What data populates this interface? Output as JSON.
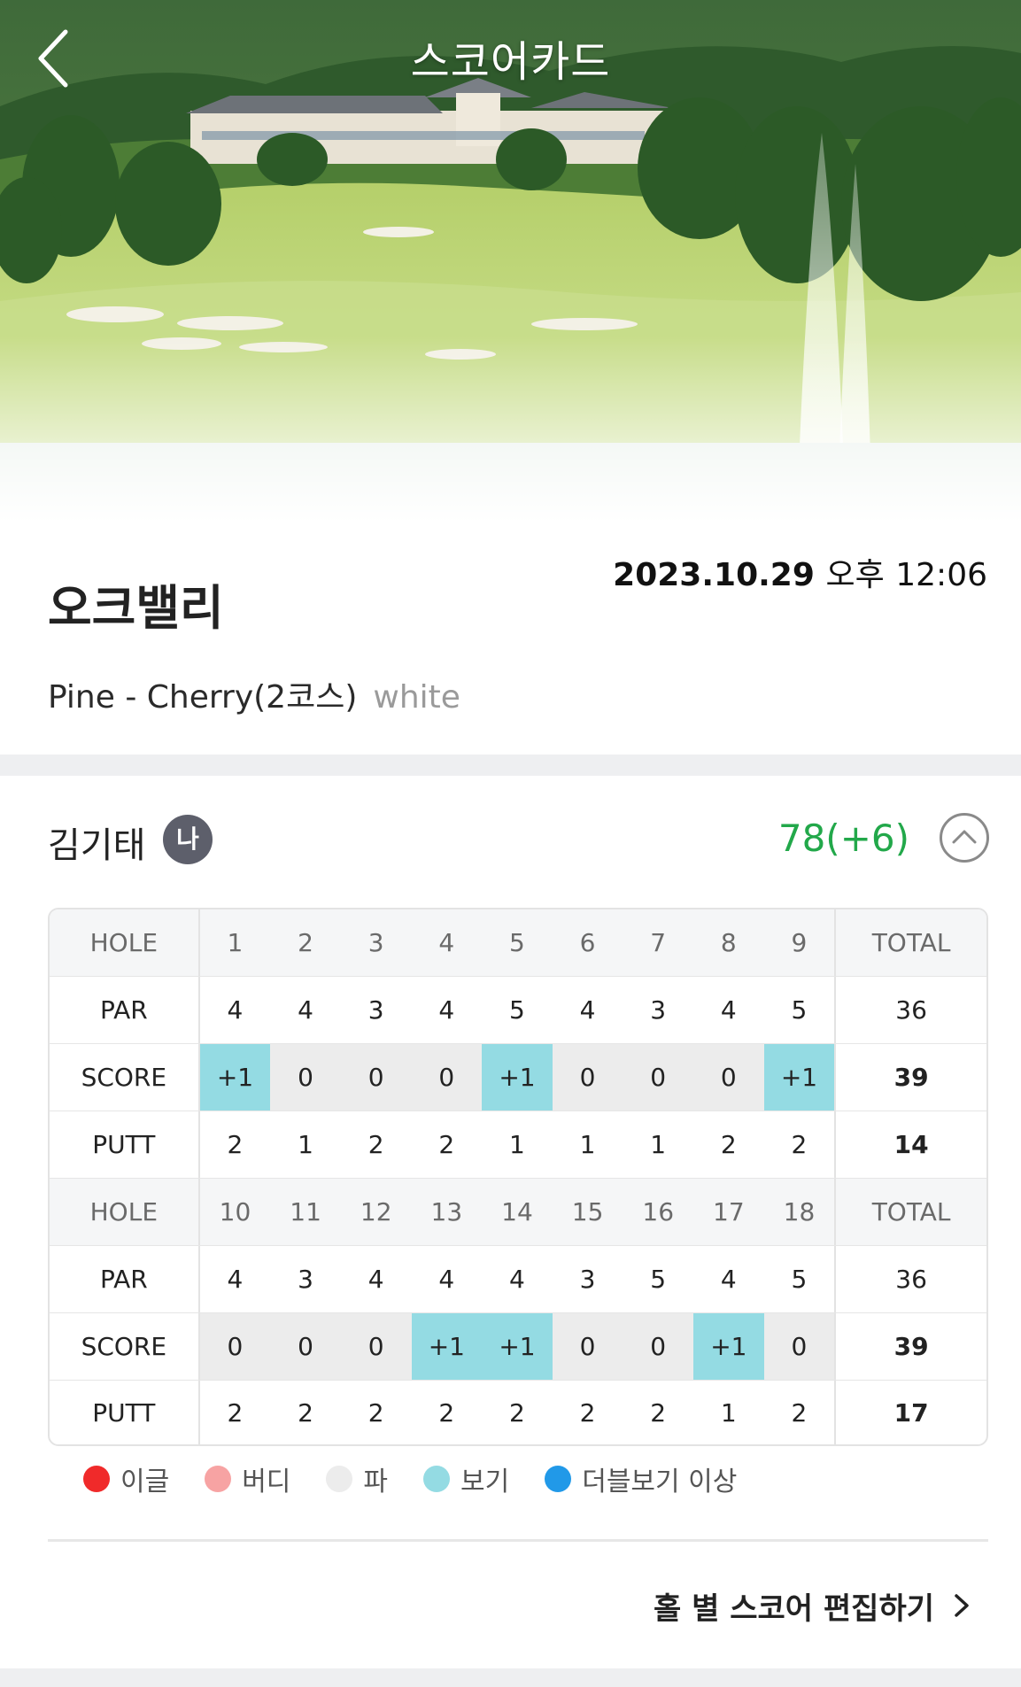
{
  "header": {
    "title": "스코어카드"
  },
  "course": {
    "name": "오크밸리",
    "date": "2023.10.29",
    "time_period": "오후",
    "time": "12:06",
    "layout": "Pine - Cherry(2코스)",
    "tee": "white"
  },
  "player": {
    "name": "김기태",
    "badge": "나",
    "total": "78(+6)"
  },
  "scorecard": {
    "row_labels": {
      "hole": "HOLE",
      "par": "PAR",
      "score": "SCORE",
      "putt": "PUTT",
      "total": "TOTAL"
    },
    "front": {
      "holes": [
        "1",
        "2",
        "3",
        "4",
        "5",
        "6",
        "7",
        "8",
        "9"
      ],
      "par": [
        "4",
        "4",
        "3",
        "4",
        "5",
        "4",
        "3",
        "4",
        "5"
      ],
      "score": [
        "+1",
        "0",
        "0",
        "0",
        "+1",
        "0",
        "0",
        "0",
        "+1"
      ],
      "putt": [
        "2",
        "1",
        "2",
        "2",
        "1",
        "1",
        "1",
        "2",
        "2"
      ],
      "par_total": "36",
      "score_total": "39",
      "putt_total": "14"
    },
    "back": {
      "holes": [
        "10",
        "11",
        "12",
        "13",
        "14",
        "15",
        "16",
        "17",
        "18"
      ],
      "par": [
        "4",
        "3",
        "4",
        "4",
        "4",
        "3",
        "5",
        "4",
        "5"
      ],
      "score": [
        "0",
        "0",
        "0",
        "+1",
        "+1",
        "0",
        "0",
        "+1",
        "0"
      ],
      "putt": [
        "2",
        "2",
        "2",
        "2",
        "2",
        "2",
        "2",
        "1",
        "2"
      ],
      "par_total": "36",
      "score_total": "39",
      "putt_total": "17"
    }
  },
  "legend": [
    {
      "label": "이글",
      "color": "#f02a2a"
    },
    {
      "label": "버디",
      "color": "#f7a3a3"
    },
    {
      "label": "파",
      "color": "#ececec"
    },
    {
      "label": "보기",
      "color": "#94dbe3"
    },
    {
      "label": "더블보기 이상",
      "color": "#2199e8"
    }
  ],
  "actions": {
    "edit_label": "홀 별 스코어 편집하기"
  },
  "icons": {
    "back": "chevron-left-icon",
    "collapse": "chevron-up-icon",
    "edit": "chevron-right-icon"
  }
}
